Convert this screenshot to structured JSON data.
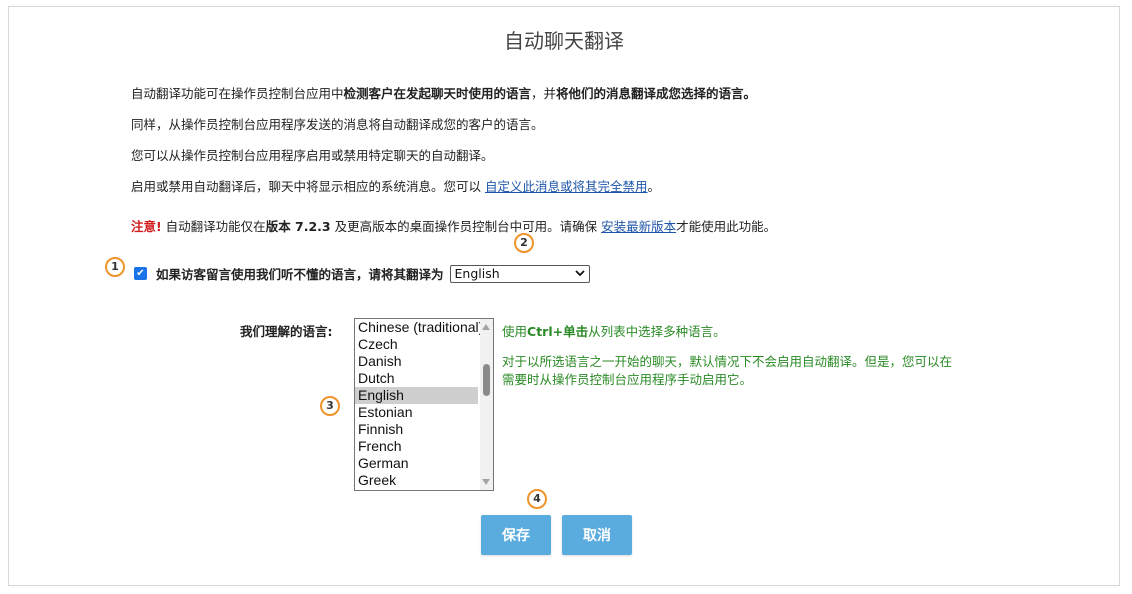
{
  "page": {
    "title": "自动聊天翻译"
  },
  "description": {
    "line1_a": "自动翻译功能可在操作员控制台应用中",
    "line1_b": "检测客户在发起聊天时使用的语言",
    "line1_c": "，并",
    "line1_d": "将他们的消息翻译成您选择的语言。",
    "line2": "同样，从操作员控制台应用程序发送的消息将自动翻译成您的客户的语言。",
    "line3": "您可以从操作员控制台应用程序启用或禁用特定聊天的自动翻译。",
    "line4_a": "启用或禁用自动翻译后，聊天中将显示相应的系统消息。您可以 ",
    "line4_link": "自定义此消息或将其完全禁用",
    "line4_b": "。"
  },
  "notice": {
    "label": "注意!",
    "text_a": " 自动翻译功能仅在",
    "version": "版本 7.2.3",
    "text_b": " 及更高版本的桌面操作员控制台中可用。请确保 ",
    "link": "安装最新版本",
    "text_c": "才能使用此功能。"
  },
  "translate_option": {
    "checked": true,
    "label": "如果访客留言使用我们听不懂的语言，请将其翻译为",
    "selected_language": "English"
  },
  "languages": {
    "label": "我们理解的语言:",
    "options": [
      "Chinese (traditional)",
      "Czech",
      "Danish",
      "Dutch",
      "English",
      "Estonian",
      "Finnish",
      "French",
      "German",
      "Greek"
    ],
    "selected": "English"
  },
  "hints": {
    "hint1_a": "使用",
    "hint1_b": "Ctrl+单击",
    "hint1_c": "从列表中选择多种语言。",
    "hint2_line1": "对于以所选语言之一开始的聊天，默认情况下不会启用自动翻译。但是，您可以在",
    "hint2_line2": "需要时从操作员控制台应用程序手动启用它。"
  },
  "buttons": {
    "save": "保存",
    "cancel": "取消"
  },
  "badges": [
    "1",
    "2",
    "3",
    "4"
  ],
  "colors": {
    "badge_border": "#f0932b",
    "button": "#5aacdf",
    "hint": "#2a8a25",
    "warning": "#d21e1e",
    "link": "#1f57a8"
  },
  "icons": {
    "checkbox": "check-icon",
    "select_arrow": "chevron-down-icon"
  }
}
